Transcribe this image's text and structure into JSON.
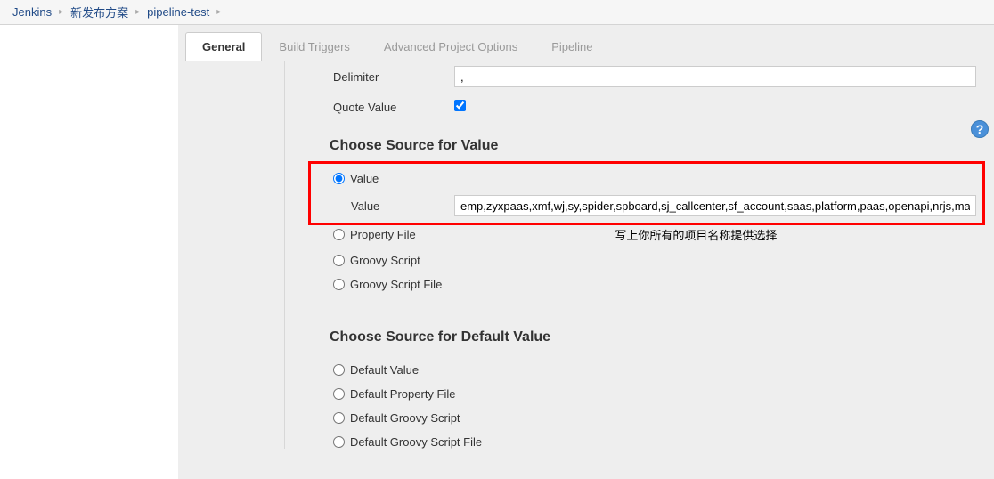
{
  "breadcrumb": {
    "items": [
      "Jenkins",
      "新发布方案",
      "pipeline-test"
    ]
  },
  "tabs": {
    "items": [
      {
        "label": "General",
        "active": true
      },
      {
        "label": "Build Triggers",
        "active": false
      },
      {
        "label": "Advanced Project Options",
        "active": false
      },
      {
        "label": "Pipeline",
        "active": false
      }
    ]
  },
  "form": {
    "delimiter": {
      "label": "Delimiter",
      "value": ","
    },
    "quote_value": {
      "label": "Quote Value",
      "checked": true
    }
  },
  "source_for_value": {
    "heading": "Choose Source for Value",
    "options": {
      "value": {
        "label": "Value",
        "selected": true
      },
      "property_file": {
        "label": "Property File",
        "selected": false
      },
      "groovy_script": {
        "label": "Groovy Script",
        "selected": false
      },
      "groovy_script_file": {
        "label": "Groovy Script File",
        "selected": false
      }
    },
    "value_field": {
      "label": "Value",
      "value": "emp,zyxpaas,xmf,wj,sy,spider,spboard,sj_callcenter,sf_account,saas,platform,paas,openapi,nrjs,ma"
    }
  },
  "source_for_default": {
    "heading": "Choose Source for Default Value",
    "options": {
      "default_value": {
        "label": "Default Value"
      },
      "default_property_file": {
        "label": "Default Property File"
      },
      "default_groovy_script": {
        "label": "Default Groovy Script"
      },
      "default_groovy_script_file": {
        "label": "Default Groovy Script File"
      }
    }
  },
  "annotation": {
    "text": "写上你所有的项目名称提供选择"
  },
  "help_icon_glyph": "?"
}
